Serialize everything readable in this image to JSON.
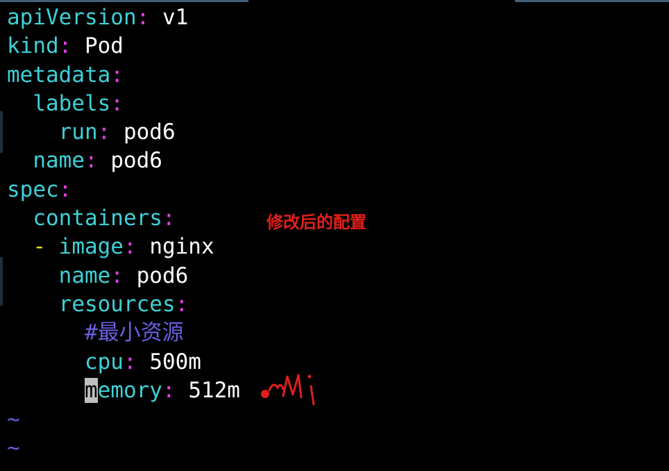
{
  "editor": {
    "lines": [
      {
        "indent": "",
        "key": "apiVersion",
        "value": "v1"
      },
      {
        "indent": "",
        "key": "kind",
        "value": "Pod"
      },
      {
        "indent": "",
        "key": "metadata",
        "value": ""
      },
      {
        "indent": "  ",
        "key": "labels",
        "value": ""
      },
      {
        "indent": "    ",
        "key": "run",
        "value": "pod6"
      },
      {
        "indent": "  ",
        "key": "name",
        "value": "pod6"
      },
      {
        "indent": "",
        "key": "spec",
        "value": ""
      },
      {
        "indent": "  ",
        "key": "containers",
        "value": ""
      },
      {
        "indent": "  ",
        "dash": "- ",
        "key": "image",
        "value": "nginx"
      },
      {
        "indent": "    ",
        "key": "name",
        "value": "pod6"
      },
      {
        "indent": "    ",
        "key": "resources",
        "value": ""
      },
      {
        "indent": "      ",
        "comment": "#最小资源"
      },
      {
        "indent": "      ",
        "key": "cpu",
        "value": "500m"
      },
      {
        "indent": "      ",
        "cursor_char": "m",
        "key_rest": "emory",
        "value": "512m"
      }
    ],
    "empty_line_marker": "~",
    "empty_line_count": 2
  },
  "annotation": {
    "text": "修改后的配置",
    "handwritten_text": "Mi"
  },
  "colors": {
    "background": "#000000",
    "key": "#3fd0d7",
    "colon": "#e040e0",
    "value": "#ffffff",
    "dash": "#e6e600",
    "comment": "#6a5fe0",
    "tilde": "#5f5fd7",
    "annotation": "#e0201a"
  }
}
